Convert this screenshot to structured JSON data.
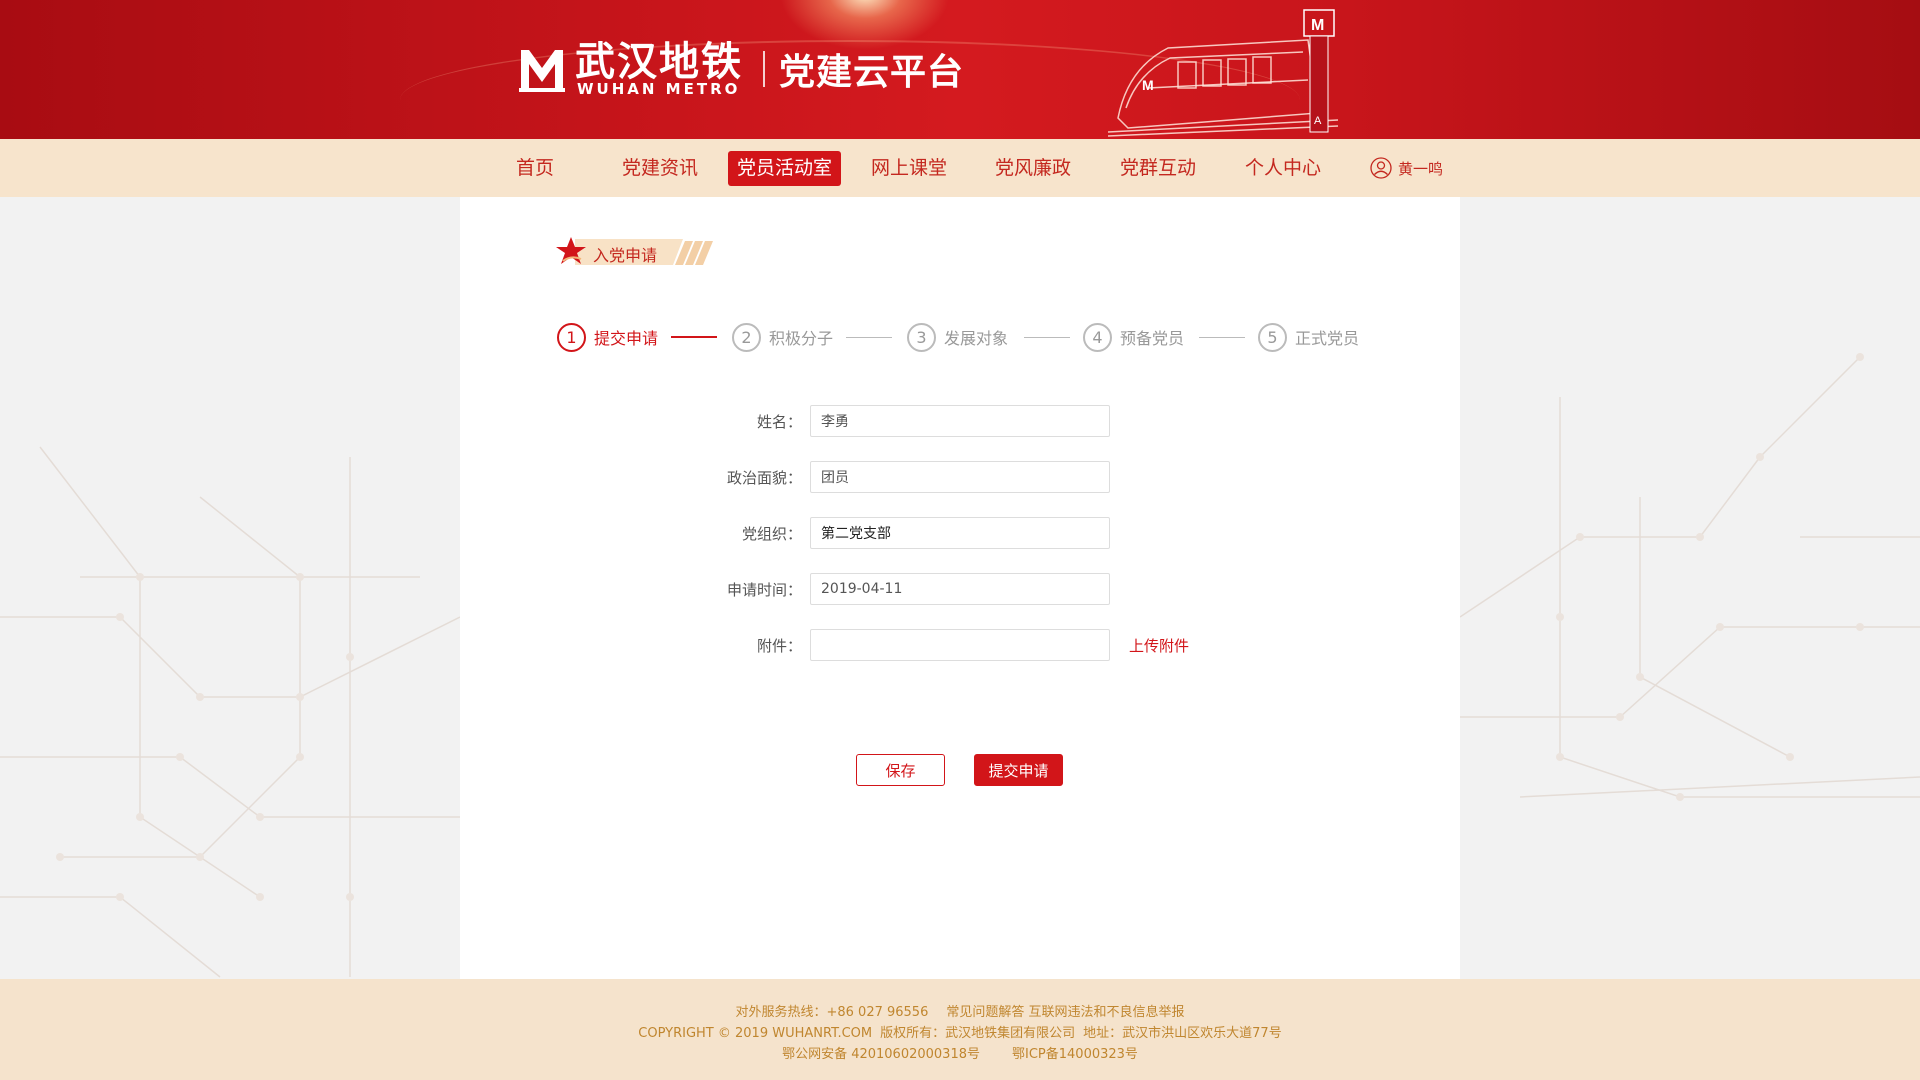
{
  "header": {
    "logo_cn": "武汉地铁",
    "logo_en": "WUHAN METRO",
    "platform_title": "党建云平台"
  },
  "nav": {
    "items": [
      {
        "label": "首页",
        "active": false
      },
      {
        "label": "党建资讯",
        "active": false
      },
      {
        "label": "党员活动室",
        "active": true
      },
      {
        "label": "网上课堂",
        "active": false
      },
      {
        "label": "党风廉政",
        "active": false
      },
      {
        "label": "党群互动",
        "active": false
      },
      {
        "label": "个人中心",
        "active": false
      }
    ],
    "user_name": "黄一鸣"
  },
  "section": {
    "title": "入党申请"
  },
  "steps": [
    {
      "num": "1",
      "label": "提交申请",
      "active": true
    },
    {
      "num": "2",
      "label": "积极分子",
      "active": false
    },
    {
      "num": "3",
      "label": "发展对象",
      "active": false
    },
    {
      "num": "4",
      "label": "预备党员",
      "active": false
    },
    {
      "num": "5",
      "label": "正式党员",
      "active": false
    }
  ],
  "form": {
    "name_label": "姓名：",
    "name_value": "李勇",
    "political_label": "政治面貌：",
    "political_value": "团员",
    "org_label": "党组织：",
    "org_value": "第二党支部",
    "date_label": "申请时间：",
    "date_value": "2019-04-11",
    "attachment_label": "附件：",
    "attachment_value": "",
    "upload_label": "上传附件"
  },
  "buttons": {
    "save": "保存",
    "submit": "提交申请"
  },
  "footer": {
    "hotline": "对外服务热线：+86 027 96556",
    "faq": "常见问题解答 互联网违法和不良信息举报",
    "copyright": "COPYRIGHT © 2019 WUHANRT.COM",
    "owner": "版权所有：武汉地铁集团有限公司",
    "address": "地址：武汉市洪山区欢乐大道77号",
    "police": "鄂公网安备 42010602000318号",
    "icp": "鄂ICP备14000323号"
  },
  "colors": {
    "brand_red": "#d21519",
    "nav_bg": "#f7e4cc",
    "footer_text": "#c0862f"
  }
}
